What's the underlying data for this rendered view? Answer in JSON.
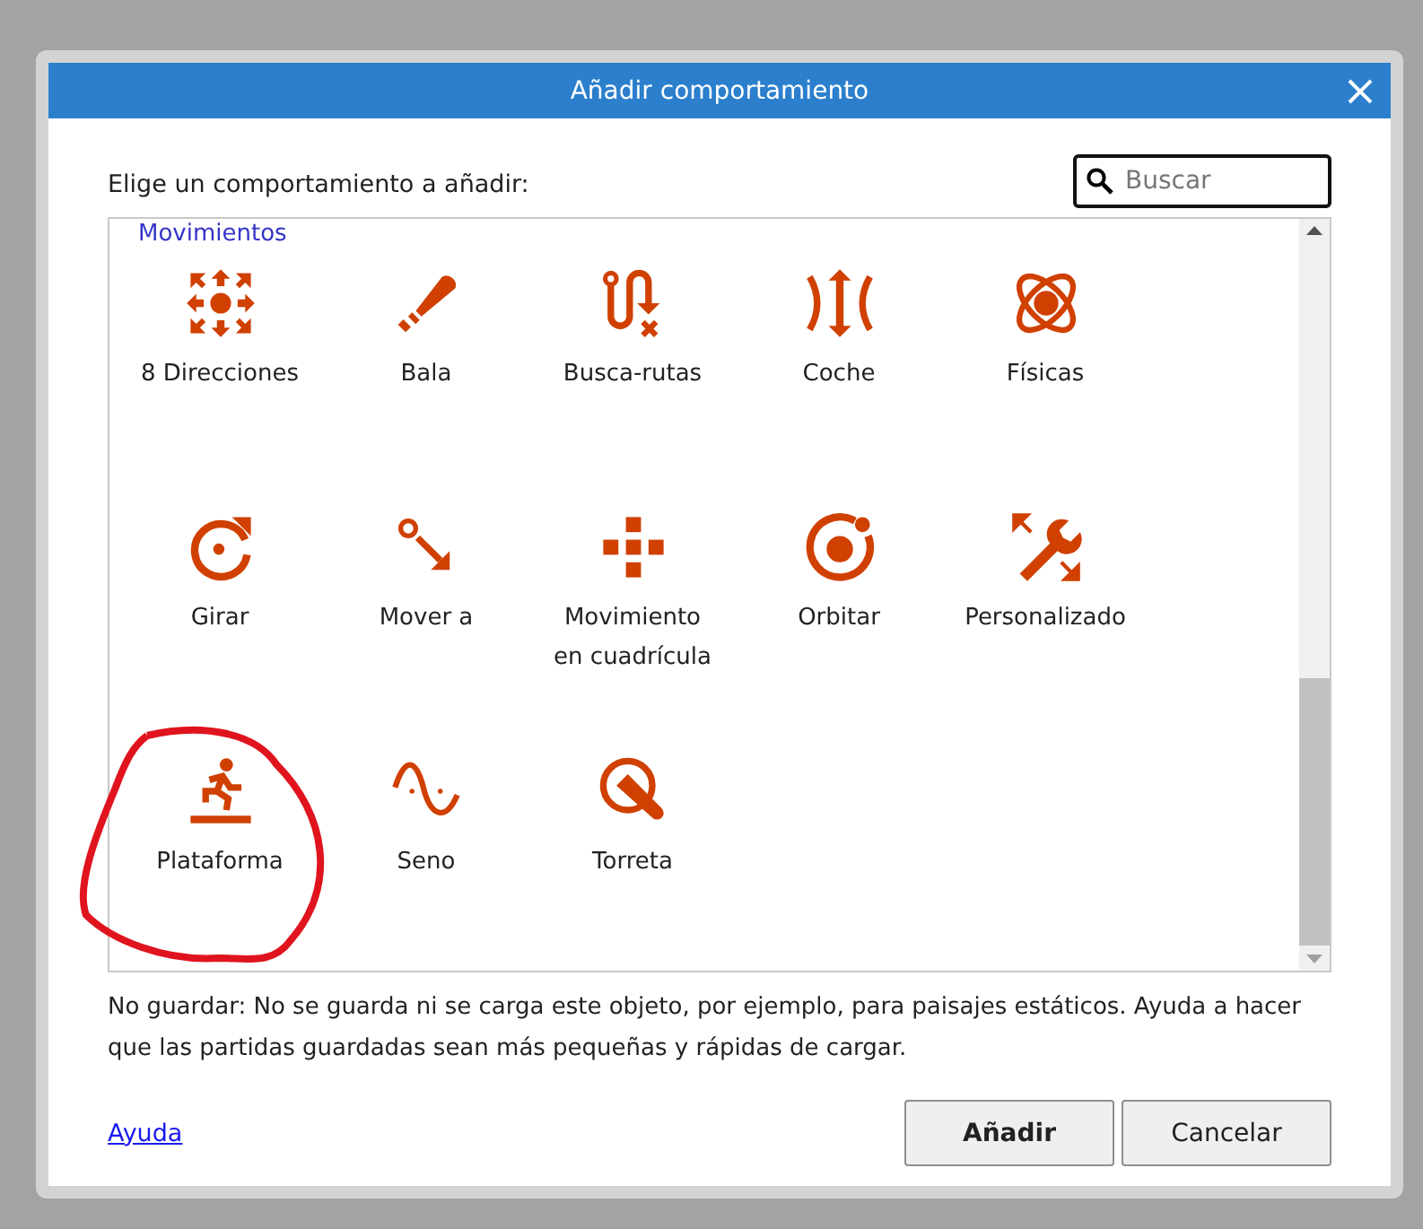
{
  "dialog": {
    "title": "Añadir comportamiento",
    "prompt": "Elige un comportamiento a añadir:",
    "search": {
      "placeholder": "Buscar"
    },
    "category": "Movimientos",
    "behaviors": [
      {
        "label": "8 Direcciones",
        "kind": "eight-directions",
        "selected": false
      },
      {
        "label": "Bala",
        "kind": "bullet",
        "selected": false
      },
      {
        "label": "Busca-rutas",
        "kind": "pathfinding",
        "selected": false
      },
      {
        "label": "Coche",
        "kind": "car",
        "selected": false
      },
      {
        "label": "Físicas",
        "kind": "physics",
        "selected": false
      },
      {
        "label": "Girar",
        "kind": "rotate",
        "selected": false
      },
      {
        "label": "Mover a",
        "kind": "move-to",
        "selected": false
      },
      {
        "label": "Movimiento en cuadrícula",
        "kind": "grid",
        "selected": false
      },
      {
        "label": "Orbitar",
        "kind": "orbit",
        "selected": false
      },
      {
        "label": "Personalizado",
        "kind": "custom",
        "selected": false
      },
      {
        "label": "Plataforma",
        "kind": "platform",
        "selected": false,
        "circled": true
      },
      {
        "label": "Seno",
        "kind": "sine",
        "selected": false
      },
      {
        "label": "Torreta",
        "kind": "turret",
        "selected": false
      }
    ],
    "description": "No guardar: No se guarda ni se carga este objeto, por ejemplo, para paisajes estáticos. Ayuda a hacer que las partidas guardadas sean más pequeñas y rápidas de cargar.",
    "help_link": "Ayuda",
    "buttons": [
      {
        "label": "Añadir",
        "kind": "primary"
      },
      {
        "label": "Cancelar",
        "kind": "secondary"
      }
    ]
  }
}
